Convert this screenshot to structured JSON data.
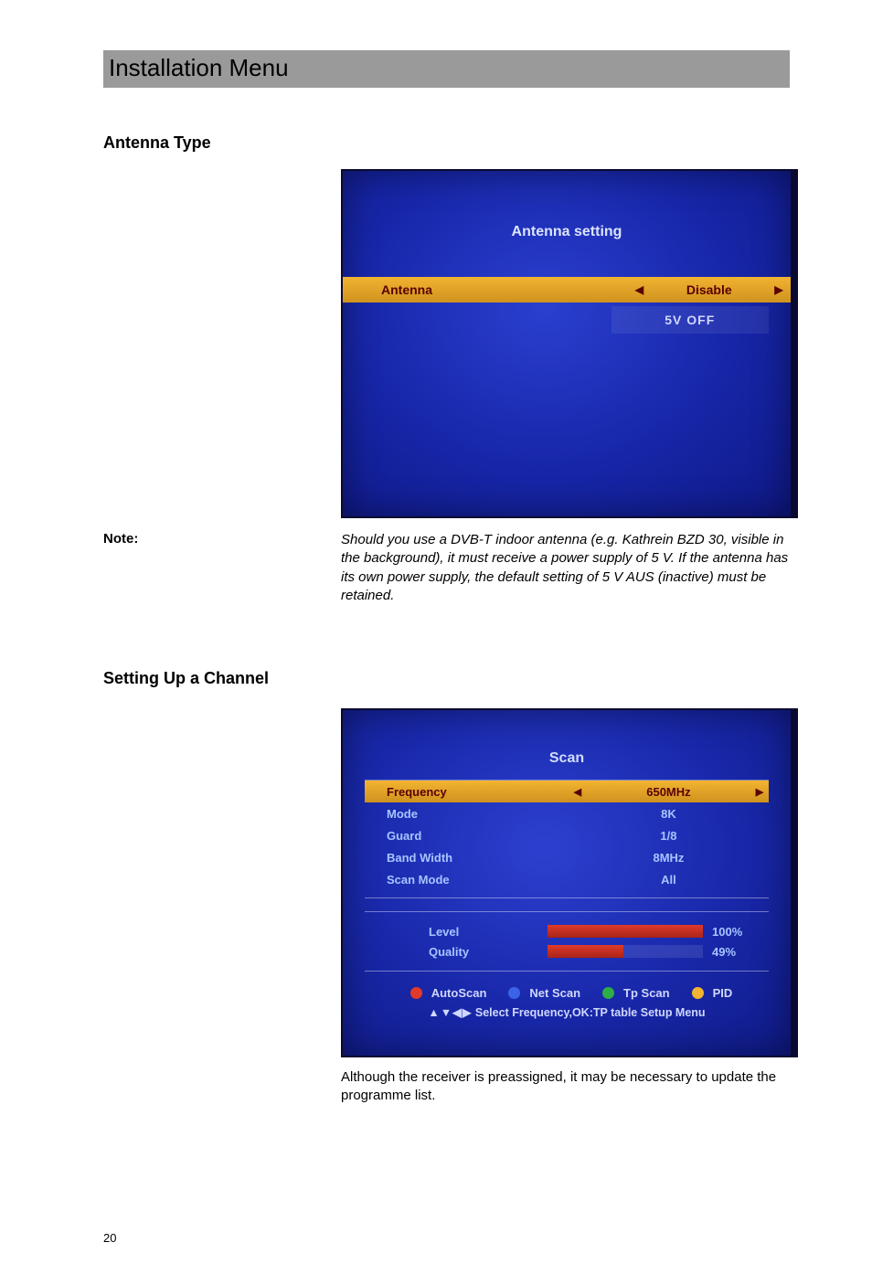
{
  "header": {
    "title": "Installation Menu"
  },
  "section1": {
    "heading": "Antenna Type",
    "note_label": "Note:",
    "note_text": "Should you use a DVB-T indoor antenna (e.g. Kathrein BZD 30, visible in the background), it must receive a power supply of 5 V. If the antenna has its own power supply, the default setting of 5 V AUS (inactive) must be retained."
  },
  "antenna_screen": {
    "title": "Antenna setting",
    "row": {
      "label": "Antenna",
      "value": "Disable"
    },
    "status": "5V OFF"
  },
  "section2": {
    "heading": "Setting Up a Channel"
  },
  "scan_screen": {
    "title": "Scan",
    "rows": [
      {
        "label": "Frequency",
        "value": "650MHz",
        "selected": true
      },
      {
        "label": "Mode",
        "value": "8K"
      },
      {
        "label": "Guard",
        "value": "1/8"
      },
      {
        "label": "Band Width",
        "value": "8MHz"
      },
      {
        "label": "Scan Mode",
        "value": "All"
      }
    ],
    "meters": {
      "level": {
        "label": "Level",
        "percent": 100
      },
      "quality": {
        "label": "Quality",
        "percent": 49
      }
    },
    "legend": [
      {
        "color": "red",
        "label": "AutoScan"
      },
      {
        "color": "blue",
        "label": "Net Scan"
      },
      {
        "color": "green",
        "label": "Tp Scan"
      },
      {
        "color": "yellow",
        "label": "PID"
      }
    ],
    "hint_symbols": "▲▼◀▶",
    "hint_text": "Select Frequency,OK:TP table Setup Menu"
  },
  "after_scan_text": "Although the receiver is preassigned, it may be necessary to update the programme list.",
  "page_number": "20"
}
